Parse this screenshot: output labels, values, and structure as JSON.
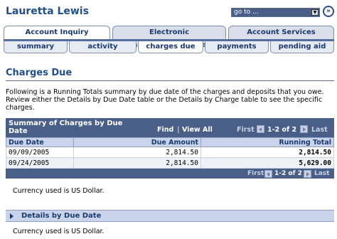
{
  "header": {
    "user_name": "Lauretta Lewis",
    "goto_value": "go to ...",
    "goto_button_icon": "double-chevron-right-icon"
  },
  "tabs_primary": [
    {
      "label": "Account Inquiry",
      "active": true
    },
    {
      "label": "Electronic Payments/Purchases",
      "active": false
    },
    {
      "label": "Account Services",
      "active": false
    }
  ],
  "tabs_secondary": [
    {
      "label": "summary",
      "active": false
    },
    {
      "label": "activity",
      "active": false
    },
    {
      "label": "charges due",
      "active": true
    },
    {
      "label": "payments",
      "active": false
    },
    {
      "label": "pending aid",
      "active": false
    }
  ],
  "page": {
    "title": "Charges Due",
    "intro": "Following is a Running Totals summary by due date of the charges and deposits that you owe. Review either the Details by Due Date table or the Details by Charge table to see the specific charges."
  },
  "summary_grid": {
    "title": "Summary of Charges by Due Date",
    "find_label": "Find",
    "view_all_label": "View All",
    "separator": "|",
    "first_label": "First",
    "range_label": "1-2 of 2",
    "last_label": "Last",
    "columns": [
      "Due Date",
      "Due Amount",
      "Running Total"
    ],
    "rows": [
      {
        "due_date": "09/09/2005",
        "due_amount": "2,814.50",
        "running_total": "2,814.50"
      },
      {
        "due_date": "09/24/2005",
        "due_amount": "2,814.50",
        "running_total": "5,629.00"
      }
    ]
  },
  "currency_note_1": "Currency used is US Dollar.",
  "details_section": {
    "label": "Details by Due Date",
    "collapsed": true
  },
  "currency_note_2": "Currency used is US Dollar.",
  "colors": {
    "header_blue": "#1f4f8f",
    "grid_header_bg": "#4a5f88",
    "column_header_bg": "#c9d3ea",
    "tab_inactive_bg": "#d9deea"
  }
}
